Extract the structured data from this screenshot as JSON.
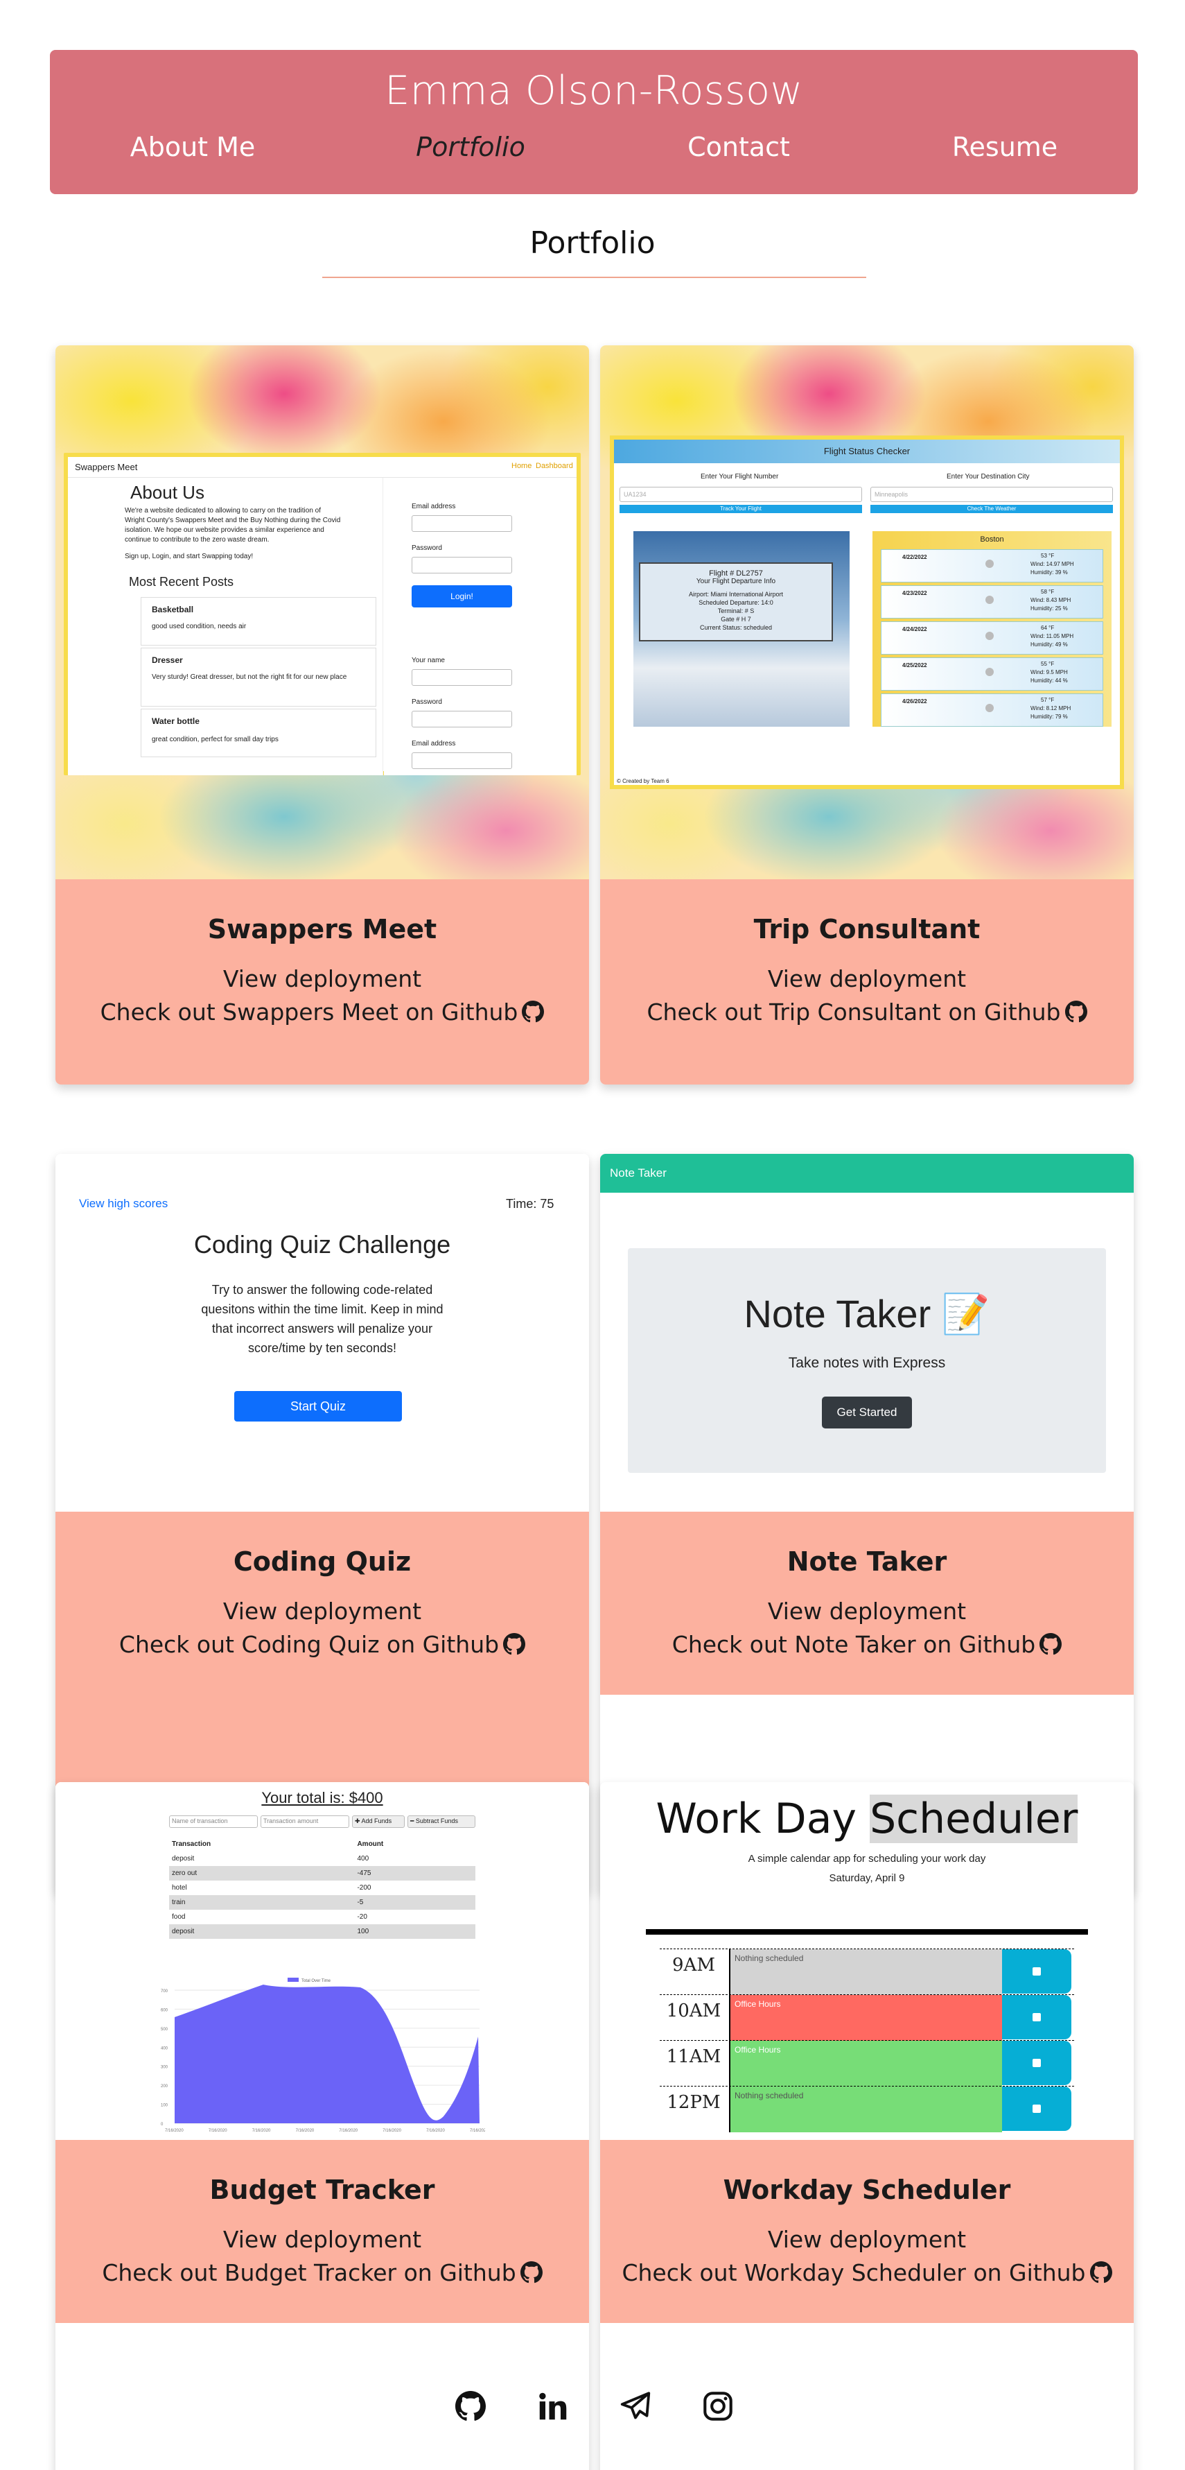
{
  "header": {
    "title": "Emma Olson-Rossow",
    "nav": [
      {
        "label": "About Me"
      },
      {
        "label": "Portfolio"
      },
      {
        "label": "Contact"
      },
      {
        "label": "Resume"
      }
    ]
  },
  "section": {
    "title": "Portfolio"
  },
  "projects": [
    {
      "name": "Swappers Meet",
      "deploy_label": "View deployment",
      "github_label": "Check out Swappers Meet on Github",
      "screenshot": {
        "brand": "Swappers Meet",
        "nav_links": [
          "Home",
          "Dashboard"
        ],
        "heading": "About Us",
        "about_text_1": "We're a website dedicated to allowing to carry on the tradition of",
        "about_text_2": "Wright County's Swappers Meet and the Buy Nothing during the Covid",
        "about_text_3": "isolation. We hope our website provides a similar experience and",
        "about_text_4": "continue to contribute to the zero waste dream.",
        "cta": "Sign up, Login, and start Swapping today!",
        "recent_heading": "Most Recent Posts",
        "posts": [
          {
            "title": "Basketball",
            "desc": "good used condition, needs air"
          },
          {
            "title": "Dresser",
            "desc": "Very sturdy! Great dresser, but not the right fit for our new place"
          },
          {
            "title": "Water bottle",
            "desc": "great condition, perfect for small day trips"
          }
        ],
        "email_label": "Email address",
        "password_label": "Password",
        "login_button": "Login!",
        "name_label": "Your name",
        "password_label_2": "Password",
        "email_label_2": "Email address"
      }
    },
    {
      "name": "Trip Consultant",
      "deploy_label": "View deployment",
      "github_label": "Check out Trip Consultant on Github",
      "screenshot": {
        "header": "Flight Status Checker",
        "flight_label": "Enter Your Flight Number",
        "city_label": "Enter Your Destination City",
        "flight_placeholder": "UA1234",
        "city_placeholder": "Minneapolis",
        "track_button": "Track Your Flight",
        "weather_button": "Check The Weather",
        "flight_info": [
          "Flight # DL2757",
          "Your Flight Departure Info",
          "Airport: Miami International Airport",
          "Scheduled Departure: 14:0",
          "Terminal: # S",
          "Gate # H 7",
          "Current Status: scheduled"
        ],
        "city": "Boston",
        "days": [
          {
            "date": "4/22/2022",
            "temp": "53 °F",
            "wind": "Wind: 14.97 MPH",
            "humidity": "Humidity: 39 %"
          },
          {
            "date": "4/23/2022",
            "temp": "58 °F",
            "wind": "Wind: 8.43 MPH",
            "humidity": "Humidity: 25 %"
          },
          {
            "date": "4/24/2022",
            "temp": "64 °F",
            "wind": "Wind: 11.05 MPH",
            "humidity": "Humidity: 49 %"
          },
          {
            "date": "4/25/2022",
            "temp": "55 °F",
            "wind": "Wind: 9.5 MPH",
            "humidity": "Humidity: 44 %"
          },
          {
            "date": "4/26/2022",
            "temp": "57 °F",
            "wind": "Wind: 8.12 MPH",
            "humidity": "Humidity: 79 %"
          }
        ],
        "footer": "© Created by Team 6"
      }
    },
    {
      "name": "Coding Quiz",
      "deploy_label": "View deployment",
      "github_label": "Check out Coding Quiz on Github",
      "screenshot": {
        "high_scores": "View high scores",
        "timer": "Time: 75",
        "title": "Coding Quiz Challenge",
        "text_1": "Try to answer the following code-related",
        "text_2": "quesitons within the time limit. Keep in mind",
        "text_3": "that incorrect answers will penalize your",
        "text_4": "score/time by ten seconds!",
        "start_button": "Start Quiz"
      }
    },
    {
      "name": "Note Taker",
      "deploy_label": "View deployment",
      "github_label": "Check out Note Taker on Github",
      "screenshot": {
        "navbar": "Note Taker",
        "title": "Note Taker",
        "emoji": "📝",
        "subtitle": "Take notes with Express",
        "button": "Get Started"
      }
    },
    {
      "name": "Budget Tracker",
      "deploy_label": "View deployment",
      "github_label": "Check out Budget Tracker on Github",
      "screenshot": {
        "total": "Your total is: $400",
        "name_placeholder": "Name of transaction",
        "amount_placeholder": "Transaction amount",
        "add_button": "✚ Add Funds",
        "subtract_button": "━ Subtract Funds",
        "col_transaction": "Transaction",
        "col_amount": "Amount",
        "rows": [
          {
            "t": "deposit",
            "a": "400"
          },
          {
            "t": "zero out",
            "a": "-475"
          },
          {
            "t": "hotel",
            "a": "-200"
          },
          {
            "t": "train",
            "a": "-5"
          },
          {
            "t": "food",
            "a": "-20"
          },
          {
            "t": "deposit",
            "a": "100"
          }
        ],
        "legend": "Total Over Time",
        "y_ticks": [
          "700",
          "600",
          "500",
          "400",
          "300",
          "200",
          "100",
          "0"
        ],
        "x_ticks": [
          "7/16/2020",
          "7/16/2020",
          "7/16/2020",
          "7/16/2020",
          "7/16/2020",
          "7/16/2020",
          "7/16/2020",
          "7/16/2020"
        ],
        "chart_color": "#6b63f7"
      }
    },
    {
      "name": "Workday Scheduler",
      "deploy_label": "View deployment",
      "github_label": "Check out Workday Scheduler on Github",
      "screenshot": {
        "title_a": "Work Day ",
        "title_b": "Scheduler",
        "subtitle": "A simple calendar app for scheduling your work day",
        "date": "Saturday, April 9",
        "slots": [
          {
            "hour": "9AM",
            "text": "Nothing scheduled",
            "color": "#d3d3d3"
          },
          {
            "hour": "10AM",
            "text": "Office Hours",
            "color": "#ff6961"
          },
          {
            "hour": "11AM",
            "text": "Office Hours",
            "color": "#77dd77"
          },
          {
            "hour": "12PM",
            "text": "Nothing scheduled",
            "color": "#77dd77"
          }
        ]
      }
    }
  ],
  "footer": {
    "icons": [
      "github-icon",
      "linkedin-icon",
      "telegram-icon",
      "instagram-icon"
    ]
  },
  "colors": {
    "header_bg": "#d8717b",
    "card_body_bg": "#fcb19f",
    "rule": "#f0a58f"
  }
}
